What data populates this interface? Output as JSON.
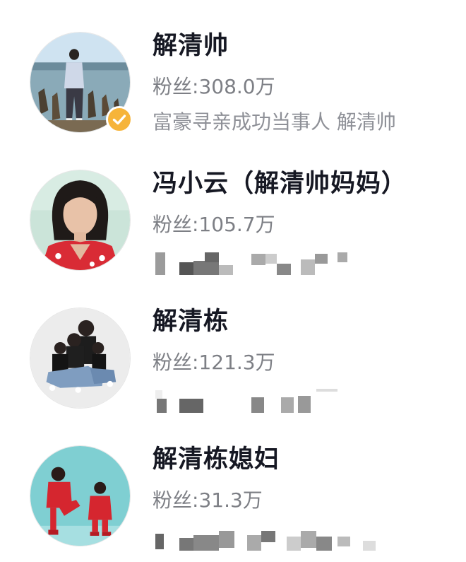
{
  "users": [
    {
      "name": "解清帅",
      "fans_label": "粉丝",
      "fans_value": "308.0万",
      "bio": "富豪寻亲成功当事人 解清帅",
      "verified": true
    },
    {
      "name": "冯小云（解清帅妈妈）",
      "fans_label": "粉丝",
      "fans_value": "105.7万",
      "bio_redacted": true
    },
    {
      "name": "解清栋",
      "fans_label": "粉丝",
      "fans_value": "121.3万",
      "bio_redacted": true
    },
    {
      "name": "解清栋媳妇",
      "fans_label": "粉丝",
      "fans_value": "31.3万",
      "bio_redacted": true
    }
  ],
  "colors": {
    "name": "#161823",
    "meta": "#7d7f85",
    "verified_badge": "#f6b43a"
  },
  "icons": {
    "verified": "check-badge-icon"
  }
}
